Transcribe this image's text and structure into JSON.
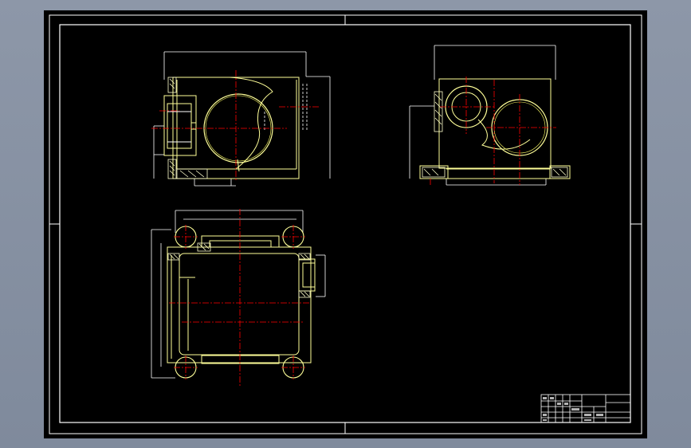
{
  "viewport": {
    "background": "#8a94a5",
    "sheet_color": "#000000",
    "frame_color": "#ffffff",
    "outline_color": "#ffff99",
    "center_line_color": "#ff0000",
    "dim_color": "#ffffff"
  },
  "drawing": {
    "views": [
      "front-view",
      "side-view",
      "top-view"
    ]
  },
  "title_block": {
    "cells": [
      "",
      "",
      "",
      "",
      ""
    ]
  }
}
